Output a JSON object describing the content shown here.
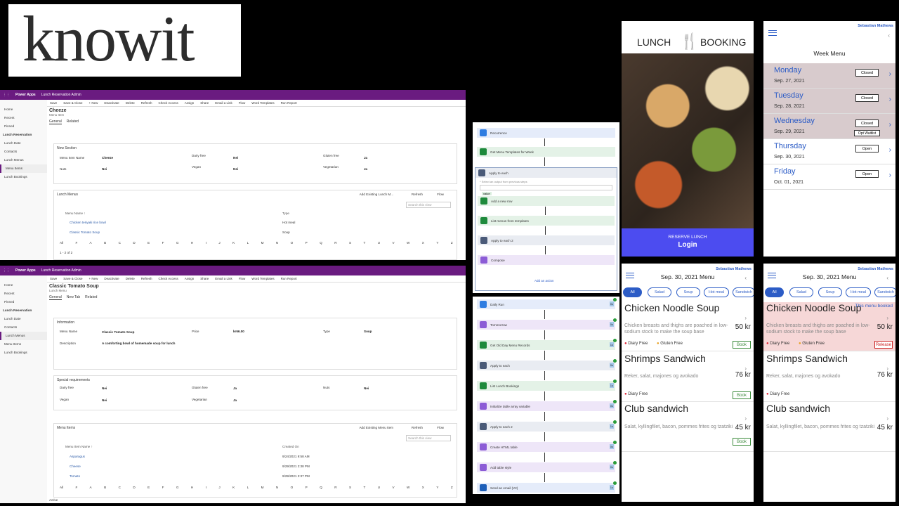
{
  "logo": {
    "text": "knowit"
  },
  "pa1": {
    "app": "Power Apps",
    "env": "Lunch Reservation Admin",
    "toolbar": [
      "Save",
      "Save & Close",
      "+ New",
      "Deactivate",
      "Delete",
      "Refresh",
      "Check Access",
      "Assign",
      "Share",
      "Email a Link",
      "Flow",
      "Word Templates",
      "Run Report"
    ],
    "nav": [
      "Home",
      "Recent",
      "Pinned",
      "Lunch Reservation",
      "Lunch Date",
      "Contacts",
      "Lunch Menus",
      "Menu Items",
      "Lunch Bookings"
    ],
    "title": "Cheeze",
    "subtitle": "Menu Item",
    "tabs": [
      "General",
      "Related"
    ],
    "section": "New Section",
    "fields": {
      "name_label": "Menu Item Name",
      "name_val": "Cheeze",
      "dairy_label": "Dairy free",
      "dairy_val": "Nei",
      "gluten_label": "Gluten free",
      "gluten_val": "Ja",
      "nuts_label": "Nuts",
      "nuts_val": "Nei",
      "vegan_label": "Vegan",
      "vegan_val": "Nei",
      "veg_label": "Vegetarian",
      "veg_val": "Ja"
    },
    "grid_title": "Lunch Menus",
    "grid_actions": [
      "Add Existing Lunch M...",
      "Refresh",
      "Flow"
    ],
    "search_placeholder": "Search this view",
    "cols": [
      "Menu Name ↑",
      "Type"
    ],
    "rows": [
      [
        "Chicken teriyaki rice bowl",
        "Hot meal"
      ],
      [
        "Classic Tomato Soup",
        "Soup"
      ]
    ],
    "alpha": [
      "All",
      "#",
      "A",
      "B",
      "C",
      "D",
      "E",
      "F",
      "G",
      "H",
      "I",
      "J",
      "K",
      "L",
      "M",
      "N",
      "O",
      "P",
      "Q",
      "R",
      "S",
      "T",
      "U",
      "V",
      "W",
      "X",
      "Y",
      "Z"
    ],
    "count": "1 - 2 of 2"
  },
  "pa2": {
    "app": "Power Apps",
    "env": "Lunch Reservation Admin",
    "toolbar": [
      "Save",
      "Save & Close",
      "+ New",
      "Deactivate",
      "Delete",
      "Refresh",
      "Check Access",
      "Assign",
      "Share",
      "Email a Link",
      "Flow",
      "Word Templates",
      "Run Report"
    ],
    "nav": [
      "Home",
      "Recent",
      "Pinned",
      "Lunch Reservation",
      "Lunch Date",
      "Contacts",
      "Lunch Menus",
      "Menu Items",
      "Lunch Bookings"
    ],
    "title": "Classic Tomato Soup",
    "subtitle": "Lunch Menu",
    "tabs": [
      "General",
      "New Tab",
      "Related"
    ],
    "section": "Information",
    "menu_label": "Menu Name",
    "menu_val": "Classic Tomato Soup",
    "price_label": "Price",
    "price_val": "kr66.00",
    "type_label": "Type",
    "type_val": "Soup",
    "desc_label": "Description",
    "desc_val": "A comforting bowl of homemade soup for lunch",
    "special": "Special requirements",
    "sp": {
      "dairy": "Dairy free",
      "dairy_v": "Nei",
      "gluten": "Gluten free",
      "gluten_v": "Ja",
      "nuts": "Nuts",
      "nuts_v": "Nei",
      "vegan": "Vegan",
      "vegan_v": "Nei",
      "veg": "Vegetarian",
      "veg_v": "Ja"
    },
    "grid_title": "Menu Items",
    "grid_actions": [
      "Add Existing Menu Item",
      "Refresh",
      "Flow"
    ],
    "search_placeholder": "Search this view",
    "cols": [
      "Menu Item Name ↑",
      "Created On"
    ],
    "rows": [
      [
        "Asparagus",
        "9/24/2021 9:58 AM"
      ],
      [
        "Cheese",
        "9/29/2021 2:38 PM"
      ],
      [
        "Tomato",
        "9/29/2021 2:37 PM"
      ]
    ],
    "status": "Active"
  },
  "flow1": {
    "steps": [
      "Recurrence",
      "Get Menu Templates for Week",
      "Apply to each",
      "Add a new row",
      "List menus from templates",
      "Apply to each 2",
      "Compose"
    ],
    "select_hint": "* Select an output from previous steps",
    "token": "value",
    "add_action": "Add an action"
  },
  "flow2": {
    "steps": [
      "Daily Run",
      "Tommorrow",
      "Get Old Day Menu Records",
      "Apply to each",
      "List Lunch Bookings",
      "Initialize table array variable",
      "Apply to each 2",
      "Create HTML table",
      "Add table style",
      "Send an email (V2)"
    ],
    "durations": [
      "0s",
      "0s",
      "1s",
      "0s",
      "1s",
      "0s",
      "1s",
      "0s",
      "0s",
      "1s"
    ]
  },
  "splash": {
    "left": "LUNCH",
    "right": "BOOKING",
    "cta_small": "RESERVE LUNCH",
    "cta_big": "Login",
    "accent": "#4c4cf0"
  },
  "week": {
    "user": "Sebastian Mathews",
    "title": "Week Menu",
    "days": [
      {
        "name": "Monday",
        "date": "Sep. 27, 2021",
        "btn": "Closed"
      },
      {
        "name": "Tuesday",
        "date": "Sep. 28, 2021",
        "btn": "Closed"
      },
      {
        "name": "Wednesday",
        "date": "Sep. 29, 2021",
        "btn": "Closed",
        "extra": "Opt Waitlist"
      },
      {
        "name": "Thursday",
        "date": "Sep. 30, 2021",
        "btn": "Open"
      },
      {
        "name": "Friday",
        "date": "Oct. 01, 2021",
        "btn": "Open"
      }
    ]
  },
  "menu1": {
    "user": "Sebastian Mathews",
    "title": "Sep. 30, 2021 Menu",
    "filters": [
      "All",
      "Salad",
      "Soup",
      "Hot meal",
      "Sandwich"
    ],
    "dishes": [
      {
        "name": "Chicken Noodle Soup",
        "desc": "Chicken breasts and thighs are poached in low-sodium stock to make the soup base",
        "price": "50 kr",
        "tags": [
          "Diary Free",
          "Gluten Free"
        ],
        "btn": "Book"
      },
      {
        "name": "Shrimps Sandwich",
        "desc": "Reker, salat, majones og avokado",
        "price": "76 kr",
        "tags": [
          "Diary Free"
        ],
        "btn": "Book"
      },
      {
        "name": "Club sandwich",
        "desc": "Salat, kyllingfilet, bacon, pommes frites og tzatziki",
        "price": "45 kr",
        "tags": [],
        "btn": "Book"
      }
    ]
  },
  "menu2": {
    "user": "Sebastian Mathews",
    "title": "Sep. 30, 2021 Menu",
    "filters": [
      "All",
      "Salad",
      "Soup",
      "Hot meal",
      "Sandwich"
    ],
    "booked_note": "This menu booked",
    "dishes": [
      {
        "name": "Chicken Noodle Soup",
        "desc": "Chicken breasts and thighs are poached in low-sodium stock to make the soup base",
        "price": "50 kr",
        "tags": [
          "Diary Free",
          "Gluten Free"
        ],
        "btn": "Release"
      },
      {
        "name": "Shrimps Sandwich",
        "desc": "Reker, salat, majones og avokado",
        "price": "76 kr",
        "tags": [
          "Diary Free"
        ]
      },
      {
        "name": "Club sandwich",
        "desc": "Salat, kyllingfilet, bacon, pommes frites og tzatziki",
        "price": "45 kr",
        "tags": []
      }
    ]
  }
}
